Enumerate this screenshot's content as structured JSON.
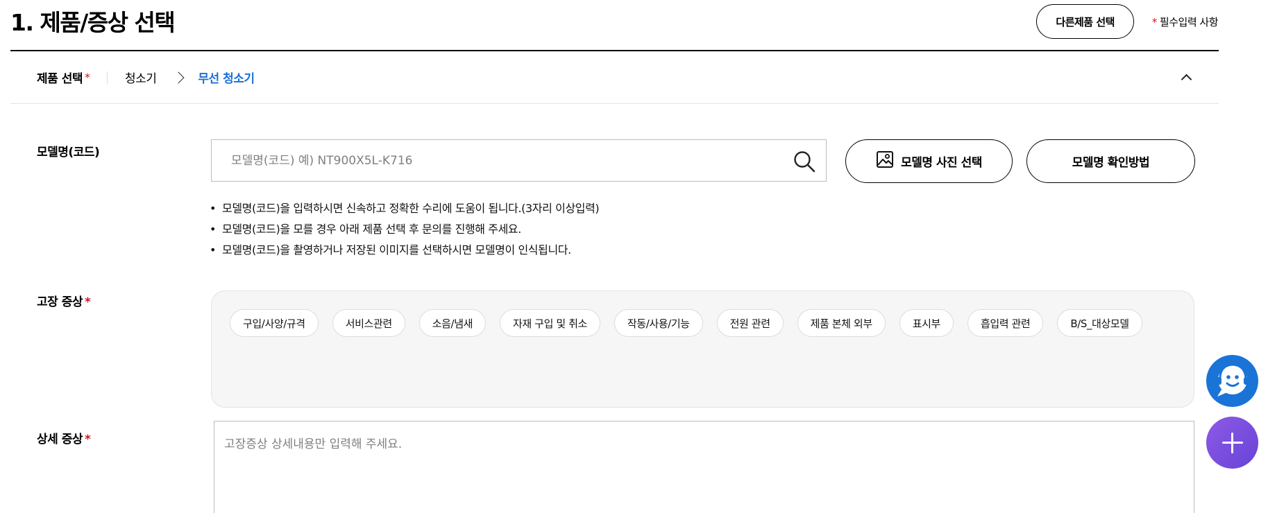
{
  "header": {
    "title": "1. 제품/증상 선택",
    "other_product_button": "다른제품 선택",
    "required_star": "*",
    "required_note": "필수입력 사항"
  },
  "product_select": {
    "label": "제품 선택",
    "required_star": "*",
    "breadcrumb": [
      "청소기",
      "무선 청소기"
    ]
  },
  "model": {
    "label": "모델명(코드)",
    "placeholder": "모델명(코드) 예) NT900X5L-K716",
    "value": "",
    "photo_button": "모델명 사진 선택",
    "howto_button": "모델명 확인방법",
    "notes": [
      "모델명(코드)을 입력하시면 신속하고 정확한 수리에 도움이 됩니다.(3자리 이상입력)",
      "모델명(코드)을 모를 경우 아래 제품 선택 후 문의를 진행해 주세요.",
      "모델명(코드)을 촬영하거나 저장된 이미지를 선택하시면 모델명이 인식됩니다."
    ]
  },
  "symptom": {
    "label": "고장 증상",
    "required_star": "*",
    "chips": [
      "구입/사양/규격",
      "서비스관련",
      "소음/냄새",
      "자재 구입 및 취소",
      "작동/사용/기능",
      "전원 관련",
      "제품 본체 외부",
      "표시부",
      "흡입력 관련",
      "B/S_대상모델"
    ]
  },
  "detail": {
    "label": "상세 증상",
    "required_star": "*",
    "placeholder": "고장증상 상세내용만 입력해 주세요.",
    "value": ""
  },
  "colors": {
    "accent_blue": "#1a6fd8",
    "required_red": "#d8121f",
    "chatbot_blue": "#1a74d8",
    "fab_purple": "#7b4fe0"
  },
  "icons": {
    "search": "search-icon",
    "photo": "image-icon",
    "collapse": "chevron-up-icon",
    "chatbot": "chatbot-icon",
    "plus": "plus-icon"
  }
}
